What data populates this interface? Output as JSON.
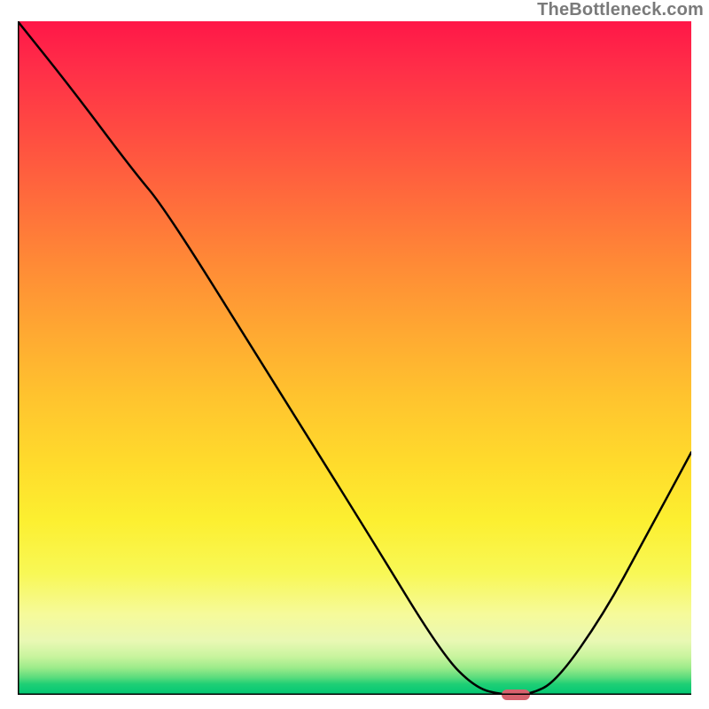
{
  "attribution": "TheBottleneck.com",
  "colors": {
    "curve": "#000000",
    "marker": "#d8626e",
    "axis": "#000000"
  },
  "chart_data": {
    "type": "line",
    "title": "",
    "xlabel": "",
    "ylabel": "",
    "xlim": [
      0,
      100
    ],
    "ylim": [
      0,
      100
    ],
    "grid": false,
    "series": [
      {
        "name": "bottleneck-curve",
        "x": [
          0,
          8,
          17,
          22,
          37,
          52,
          63,
          68,
          72,
          76,
          80,
          87,
          93,
          100
        ],
        "values": [
          100,
          90,
          78,
          72,
          48,
          24,
          6,
          1,
          0,
          0,
          2,
          12,
          23,
          36
        ]
      }
    ],
    "annotations": [
      {
        "name": "optimal-marker",
        "x": 74,
        "y": 0,
        "shape": "pill",
        "color": "#d8626e"
      }
    ],
    "background_gradient_stops": [
      {
        "pos": 0.0,
        "color": "#ff1748"
      },
      {
        "pos": 0.36,
        "color": "#ff8a36"
      },
      {
        "pos": 0.66,
        "color": "#ffdc2c"
      },
      {
        "pos": 0.88,
        "color": "#f6fa9a"
      },
      {
        "pos": 1.0,
        "color": "#00c774"
      }
    ]
  }
}
